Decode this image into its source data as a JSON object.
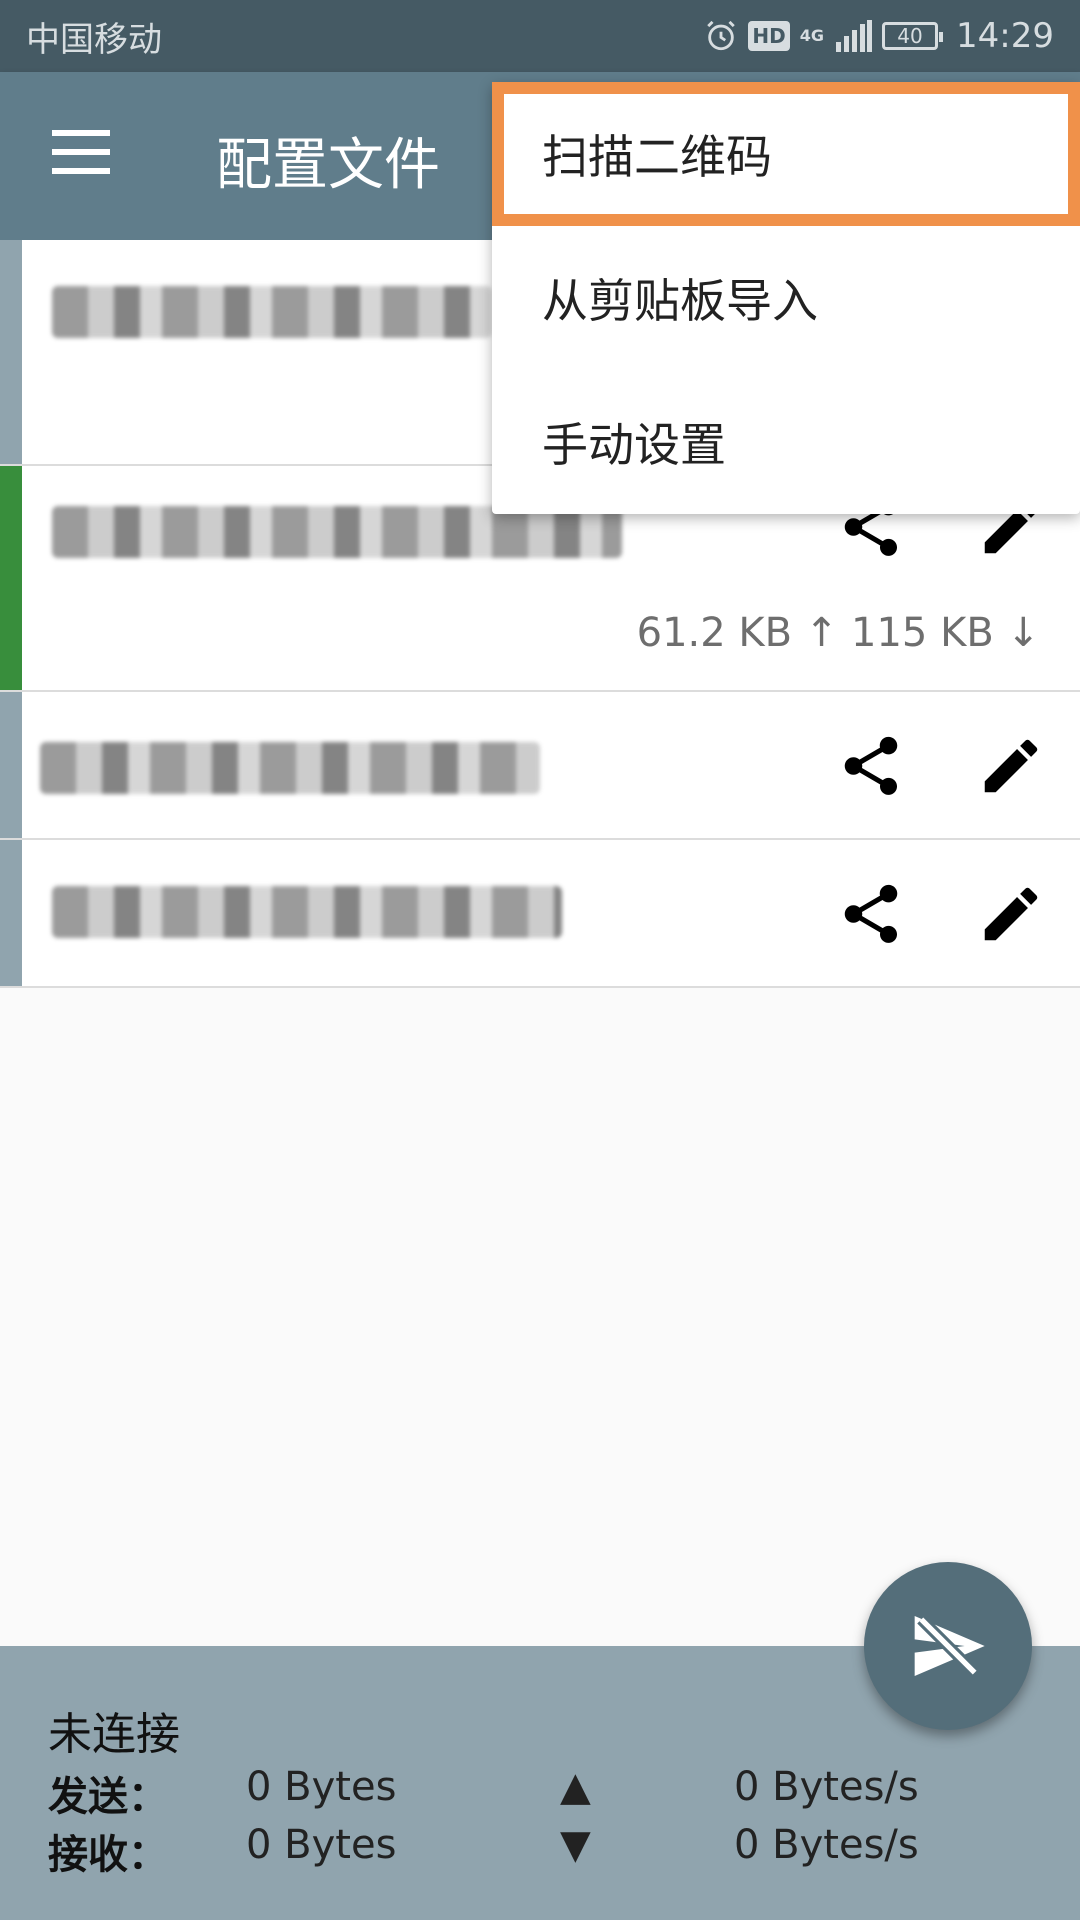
{
  "status_bar": {
    "carrier": "中国移动",
    "hd": "HD",
    "network": "4G",
    "battery": "40",
    "time": "14:29"
  },
  "toolbar": {
    "title": "配置文件",
    "menu_icon": "hamburger-menu-icon"
  },
  "popup_menu": {
    "items": [
      {
        "label": "扫描二维码",
        "highlighted": true
      },
      {
        "label": "从剪贴板导入"
      },
      {
        "label": "手动设置"
      }
    ],
    "highlight_color": "#f0914a"
  },
  "profiles": [
    {
      "name": "",
      "active": false
    },
    {
      "name": "",
      "active": true,
      "traffic": "61.2 KB ↑  115 KB ↓"
    },
    {
      "name": "",
      "active": false
    },
    {
      "name": "",
      "active": false
    }
  ],
  "bottom_panel": {
    "state": "未连接",
    "send_label": "发送：",
    "send_value": "0 Bytes",
    "send_rate": "0 Bytes/s",
    "recv_label": "接收：",
    "recv_value": "0 Bytes",
    "recv_rate": "0 Bytes/s",
    "up_arrow": "▲",
    "down_arrow": "▼"
  },
  "colors": {
    "status_bar": "#455a64",
    "toolbar": "#607d8b",
    "active_strip": "#388e3c",
    "inactive_strip": "#90a4ae",
    "bottom_panel": "#90a4ae",
    "fab": "#546e7a"
  }
}
